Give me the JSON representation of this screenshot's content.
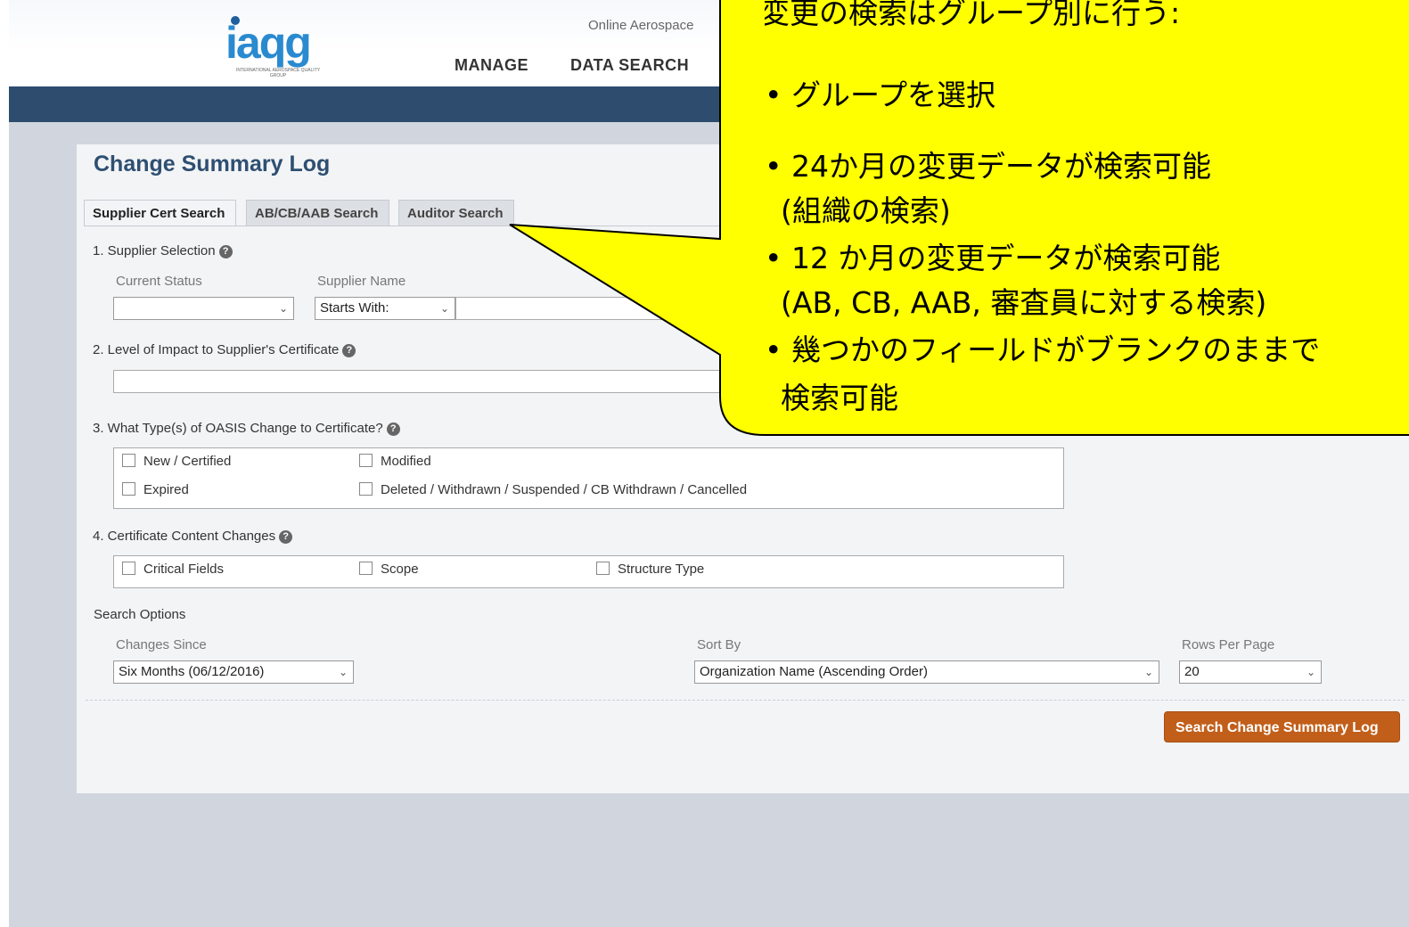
{
  "header": {
    "logo_text": "iaqg",
    "logo_subtext": "INTERNATIONAL AEROSPACE QUALITY GROUP",
    "tagline": "Online Aerospace",
    "nav": [
      "MANAGE",
      "DATA SEARCH"
    ]
  },
  "page": {
    "title": "Change Summary Log",
    "tabs": [
      "Supplier Cert Search",
      "AB/CB/AAB Search",
      "Auditor Search"
    ],
    "active_tab": "Supplier Cert Search"
  },
  "section1": {
    "label": "1. Supplier Selection",
    "current_status_label": "Current Status",
    "current_status_value": "",
    "supplier_name_label": "Supplier Name",
    "supplier_name_mode": "Starts With:",
    "supplier_name_value": ""
  },
  "section2": {
    "label": "2. Level of Impact to Supplier's Certificate",
    "value": ""
  },
  "section3": {
    "label": "3. What Type(s) of OASIS Change to Certificate?",
    "options": [
      "New / Certified",
      "Modified",
      "Expired",
      "Deleted / Withdrawn / Suspended / CB Withdrawn / Cancelled"
    ]
  },
  "section4": {
    "label": "4. Certificate Content Changes",
    "options": [
      "Critical Fields",
      "Scope",
      "Structure Type"
    ]
  },
  "search_options": {
    "label": "Search Options",
    "changes_since_label": "Changes Since",
    "changes_since_value": "Six Months (06/12/2016)",
    "sort_by_label": "Sort By",
    "sort_by_value": "Organization Name (Ascending Order)",
    "rows_per_page_label": "Rows Per Page",
    "rows_per_page_value": "20",
    "button_label": "Search Change Summary Log"
  },
  "callout": {
    "lines": [
      "変更の検索はグループ別に行う:",
      "• グループを選択",
      "• 24か月の変更データが検索可能",
      "(組織の検索)",
      "• 12 か月の変更データが検索可能",
      "(AB, CB, AAB, 審査員に対する検索)",
      "• 幾つかのフィールドがブランクのままで",
      "検索可能"
    ],
    "fill": "#ffff00"
  },
  "icons": {
    "help": "help-icon",
    "dropdown": "chevron-down-icon"
  }
}
